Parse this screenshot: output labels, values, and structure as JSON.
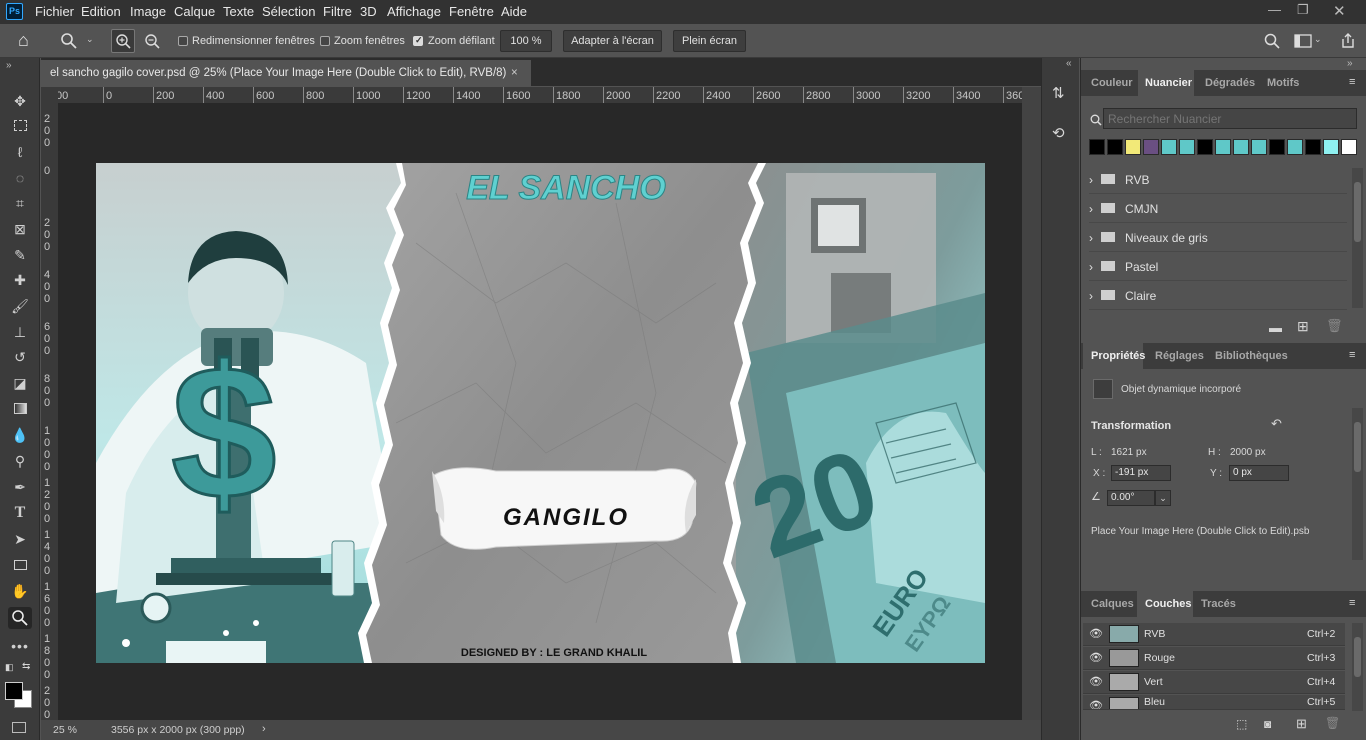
{
  "menubar": {
    "app_logo": "Ps",
    "items": [
      "Fichier",
      "Edition",
      "Image",
      "Calque",
      "Texte",
      "Sélection",
      "Filtre",
      "3D",
      "Affichage",
      "Fenêtre",
      "Aide"
    ]
  },
  "options": {
    "resize_windows": "Redimensionner fenêtres",
    "zoom_windows": "Zoom fenêtres",
    "scrubby_zoom": "Zoom défilant",
    "zoom_value": "100 %",
    "fit_screen": "Adapter à l'écran",
    "full_screen": "Plein écran"
  },
  "document": {
    "tab_title": "el sancho gagilo cover.psd @ 25% (Place Your Image Here (Double Click to Edit), RVB/8)",
    "zoom": "25 %",
    "doc_info": "3556 px x 2000 px (300 ppp)",
    "h_ruler": [
      "00",
      "0",
      "200",
      "400",
      "600",
      "800",
      "1000",
      "1200",
      "1400",
      "1600",
      "1800",
      "2000",
      "2200",
      "2400",
      "2600",
      "2800",
      "3000",
      "3200",
      "3400",
      "3600"
    ],
    "v_ruler": [
      "2 0 0",
      "0",
      "2 0 0",
      "4 0 0",
      "6 0 0",
      "8 0 0",
      "1 0 0 0",
      "1 2 0 0",
      "1 4 0 0",
      "1 6 0 0",
      "1 8 0 0",
      "2 0 0 0"
    ]
  },
  "artwork": {
    "title": "EL SANCHO",
    "name": "GANGILO",
    "credit": "DESIGNED BY : LE GRAND KHALIL",
    "banknote_value": "20",
    "banknote_text": "EURO",
    "banknote_text2": "EYPΩ"
  },
  "swatches_panel": {
    "tabs": [
      "Couleur",
      "Nuancier",
      "Dégradés",
      "Motifs"
    ],
    "search_placeholder": "Rechercher Nuancier",
    "swatch_colors": [
      "#000000",
      "#000000",
      "#f2e978",
      "#6a4f82",
      "#5fc8c8",
      "#5fc8c8",
      "#000000",
      "#5fc8c8",
      "#5fc8c8",
      "#5fc8c8",
      "#000000",
      "#5fc8c8",
      "#000000",
      "#8ff0f0",
      "#ffffff"
    ],
    "folders": [
      "RVB",
      "CMJN",
      "Niveaux de gris",
      "Pastel",
      "Claire"
    ]
  },
  "properties_panel": {
    "tabs": [
      "Propriétés",
      "Réglages",
      "Bibliothèques"
    ],
    "object_type": "Objet dynamique incorporé",
    "section": "Transformation",
    "l_label": "L :",
    "l_value": "1621 px",
    "h_label": "H :",
    "h_value": "2000 px",
    "x_label": "X :",
    "x_value": "-191 px",
    "y_label": "Y :",
    "y_value": "0 px",
    "angle_value": "0.00°",
    "linked_file": "Place Your Image Here (Double Click to Edit).psb"
  },
  "channels_panel": {
    "tabs": [
      "Calques",
      "Couches",
      "Tracés"
    ],
    "channels": [
      {
        "name": "RVB",
        "shortcut": "Ctrl+2"
      },
      {
        "name": "Rouge",
        "shortcut": "Ctrl+3"
      },
      {
        "name": "Vert",
        "shortcut": "Ctrl+4"
      },
      {
        "name": "Bleu",
        "shortcut": "Ctrl+5"
      }
    ]
  },
  "colors": {
    "accent": "#31a8ff",
    "teal": "#5fc8c8",
    "ui_dark": "#323232",
    "ui_mid": "#535353"
  }
}
